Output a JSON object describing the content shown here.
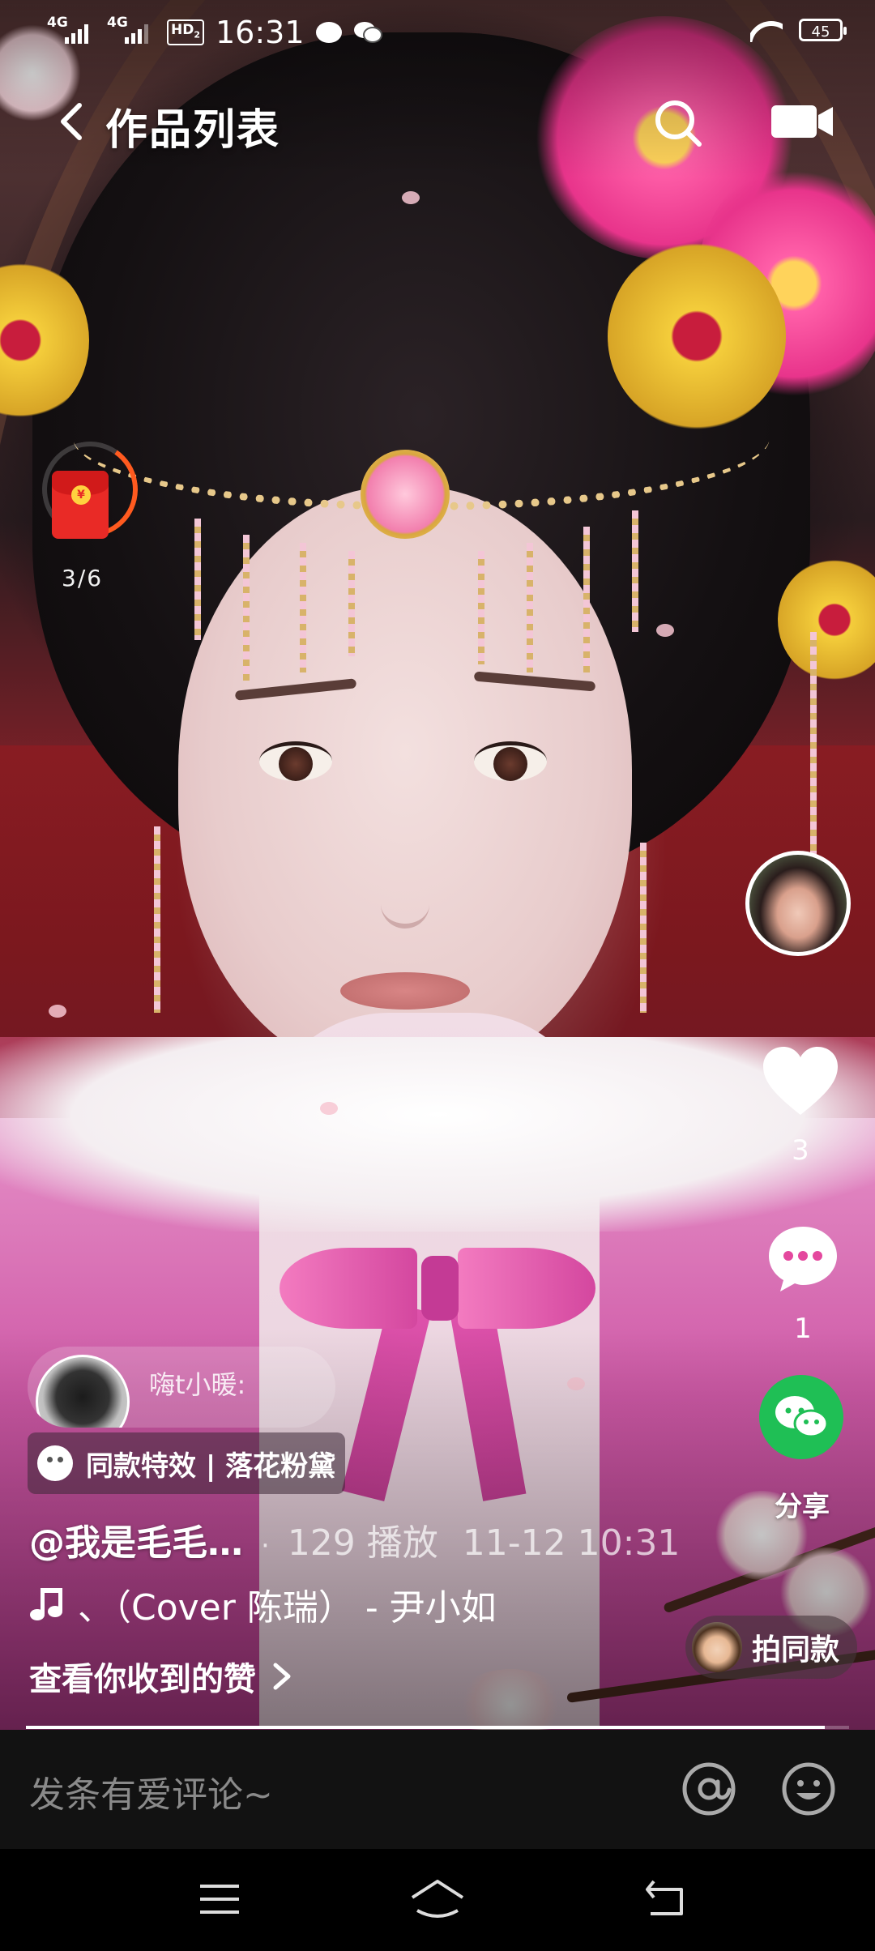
{
  "status_bar": {
    "net1": "4G",
    "net2": "4G",
    "hd": "HD",
    "hd_sub": "2",
    "time": "16:31",
    "battery": "45",
    "icons": [
      "message-icon",
      "wechat-icon",
      "wifi-icon",
      "battery-icon"
    ]
  },
  "header": {
    "back_icon": "chevron-left-icon",
    "title": "作品列表",
    "search_icon": "search-icon",
    "camera_icon": "camera-icon"
  },
  "red_envelope": {
    "progress": "3/6",
    "icon": "red-envelope-icon",
    "coin_symbol": "¥",
    "ring_color": "#ff5a1f"
  },
  "right_rail": {
    "like_count": "3",
    "comment_count": "1",
    "share_label": "分享",
    "share_color": "#1fbf55"
  },
  "video_info": {
    "comment_preview_name": "嗨t小暖:",
    "effect_label": "同款特效 | 落花粉黛",
    "author": "@我是毛毛…",
    "separator": "·",
    "plays": "129 播放",
    "date": "11-12 10:31",
    "music": "、（Cover 陈瑞） - 尹小如",
    "likes_link": "查看你收到的赞",
    "same_button": "拍同款",
    "playback_progress": 0.97
  },
  "comment_bar": {
    "placeholder": "发条有爱评论~",
    "at_icon": "at-icon",
    "emoji_icon": "emoji-icon"
  },
  "nav_bar": {
    "buttons": [
      "menu-icon",
      "home-icon",
      "back-icon"
    ]
  }
}
